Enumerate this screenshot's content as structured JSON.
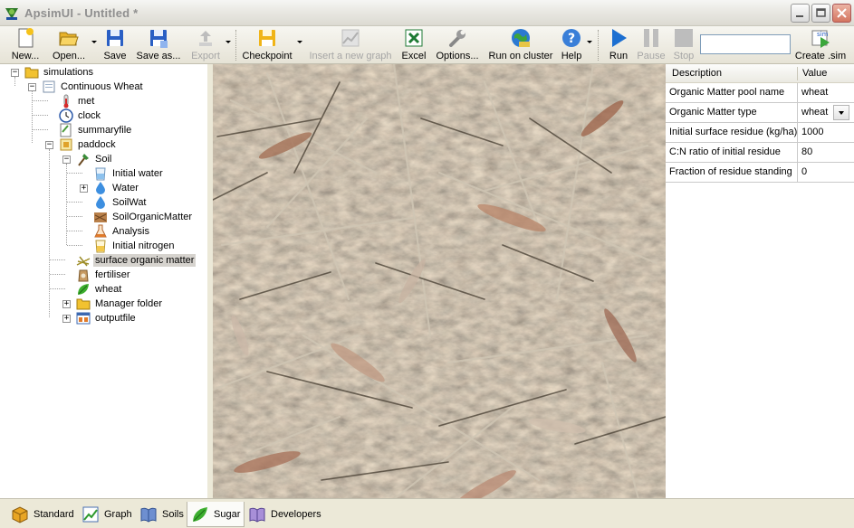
{
  "window": {
    "title": "ApsimUI - Untitled *",
    "app_icon": "apsim-app-icon"
  },
  "toolbar": {
    "buttons": [
      {
        "label": "New...",
        "icon": "new-document-icon",
        "enabled": true
      },
      {
        "label": "Open...",
        "icon": "open-folder-icon",
        "enabled": true
      },
      {
        "label": "Save",
        "icon": "save-disk-icon",
        "enabled": true
      },
      {
        "label": "Save as...",
        "icon": "save-as-disk-icon",
        "enabled": true
      },
      {
        "label": "Export",
        "icon": "export-icon",
        "enabled": false
      },
      {
        "label": "Checkpoint",
        "icon": "checkpoint-disk-icon",
        "enabled": true
      },
      {
        "label": "Insert a new graph",
        "icon": "graph-icon",
        "enabled": false
      },
      {
        "label": "Excel",
        "icon": "excel-icon",
        "enabled": true
      },
      {
        "label": "Options...",
        "icon": "wrench-icon",
        "enabled": true
      },
      {
        "label": "Run on cluster",
        "icon": "globe-icon",
        "enabled": true
      },
      {
        "label": "Help",
        "icon": "help-icon",
        "enabled": true
      },
      {
        "label": "Run",
        "icon": "play-icon",
        "enabled": true
      },
      {
        "label": "Pause",
        "icon": "pause-icon",
        "enabled": false
      },
      {
        "label": "Stop",
        "icon": "stop-icon",
        "enabled": false
      },
      {
        "label": "Create .sim",
        "icon": "create-sim-icon",
        "enabled": true
      }
    ],
    "run_input_value": ""
  },
  "tree": {
    "nodes": [
      {
        "label": "simulations",
        "icon": "folder-icon",
        "expander": "minus"
      },
      {
        "label": "Continuous Wheat",
        "icon": "simulation-icon",
        "expander": "minus"
      },
      {
        "label": "met",
        "icon": "thermometer-icon",
        "expander": ""
      },
      {
        "label": "clock",
        "icon": "clock-icon",
        "expander": ""
      },
      {
        "label": "summaryfile",
        "icon": "summaryfile-icon",
        "expander": ""
      },
      {
        "label": "paddock",
        "icon": "paddock-icon",
        "expander": "minus"
      },
      {
        "label": "Soil",
        "icon": "shovel-icon",
        "expander": "minus"
      },
      {
        "label": "Initial water",
        "icon": "beaker-icon",
        "expander": ""
      },
      {
        "label": "Water",
        "icon": "water-drop-icon",
        "expander": "plus"
      },
      {
        "label": "SoilWat",
        "icon": "water-drop-icon",
        "expander": ""
      },
      {
        "label": "SoilOrganicMatter",
        "icon": "soil-organic-icon",
        "expander": ""
      },
      {
        "label": "Analysis",
        "icon": "flask-icon",
        "expander": ""
      },
      {
        "label": "Initial nitrogen",
        "icon": "nitrogen-icon",
        "expander": ""
      },
      {
        "label": "surface organic matter",
        "icon": "residue-icon",
        "expander": "",
        "selected": true
      },
      {
        "label": "fertiliser",
        "icon": "fertiliser-bag-icon",
        "expander": ""
      },
      {
        "label": "wheat",
        "icon": "leaf-icon",
        "expander": ""
      },
      {
        "label": "Manager folder",
        "icon": "folder-icon",
        "expander": "plus"
      },
      {
        "label": "outputfile",
        "icon": "outputfile-icon",
        "expander": "plus"
      }
    ]
  },
  "grid": {
    "headers": {
      "description": "Description",
      "value": "Value"
    },
    "rows": [
      {
        "description": "Organic Matter pool name",
        "value": "wheat",
        "dropdown": false
      },
      {
        "description": "Organic Matter type",
        "value": "wheat",
        "dropdown": true
      },
      {
        "description": "Initial surface residue (kg/ha)",
        "value": "1000",
        "dropdown": false
      },
      {
        "description": "C:N ratio of initial residue",
        "value": "80",
        "dropdown": false
      },
      {
        "description": "Fraction of residue standing",
        "value": "0",
        "dropdown": false
      }
    ]
  },
  "bottom_tabs": [
    {
      "label": "Standard",
      "icon": "standard-box-icon",
      "active": false
    },
    {
      "label": "Graph",
      "icon": "graph-icon",
      "active": false
    },
    {
      "label": "Soils",
      "icon": "soils-book-icon",
      "active": false
    },
    {
      "label": "Sugar",
      "icon": "sugar-leaf-icon",
      "active": true
    },
    {
      "label": "Developers",
      "icon": "developers-book-icon",
      "active": false
    }
  ],
  "colors": {
    "window_bg": "#ece9d8",
    "selection_bg": "#d6d3ce",
    "run_blue": "#1c6fd1",
    "disabled_text": "#a6a6a6"
  }
}
